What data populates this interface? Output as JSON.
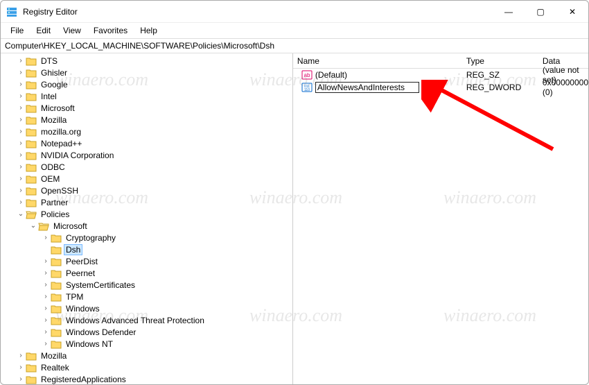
{
  "window": {
    "title": "Registry Editor",
    "controls": {
      "min": "—",
      "max": "▢",
      "close": "✕"
    }
  },
  "menu": {
    "file": "File",
    "edit": "Edit",
    "view": "View",
    "favorites": "Favorites",
    "help": "Help"
  },
  "address": "Computer\\HKEY_LOCAL_MACHINE\\SOFTWARE\\Policies\\Microsoft\\Dsh",
  "tree": {
    "items": [
      "DTS",
      "Ghisler",
      "Google",
      "Intel",
      "Microsoft",
      "Mozilla",
      "mozilla.org",
      "Notepad++",
      "NVIDIA Corporation",
      "ODBC",
      "OEM",
      "OpenSSH",
      "Partner"
    ],
    "policies": "Policies",
    "microsoft": "Microsoft",
    "ms_children": [
      "Cryptography",
      "Dsh",
      "PeerDist",
      "Peernet",
      "SystemCertificates",
      "TPM",
      "Windows",
      "Windows Advanced Threat Protection",
      "Windows Defender",
      "Windows NT"
    ],
    "after": [
      "Mozilla",
      "Realtek",
      "RegisteredApplications"
    ]
  },
  "list": {
    "headers": {
      "name": "Name",
      "type": "Type",
      "data": "Data"
    },
    "rows": [
      {
        "name": "(Default)",
        "type": "REG_SZ",
        "data": "(value not set)",
        "kind": "sz"
      },
      {
        "name": "AllowNewsAndInterests",
        "type": "REG_DWORD",
        "data": "0x00000000 (0)",
        "kind": "dword",
        "editing": true
      }
    ]
  },
  "watermark": "winaero.com"
}
